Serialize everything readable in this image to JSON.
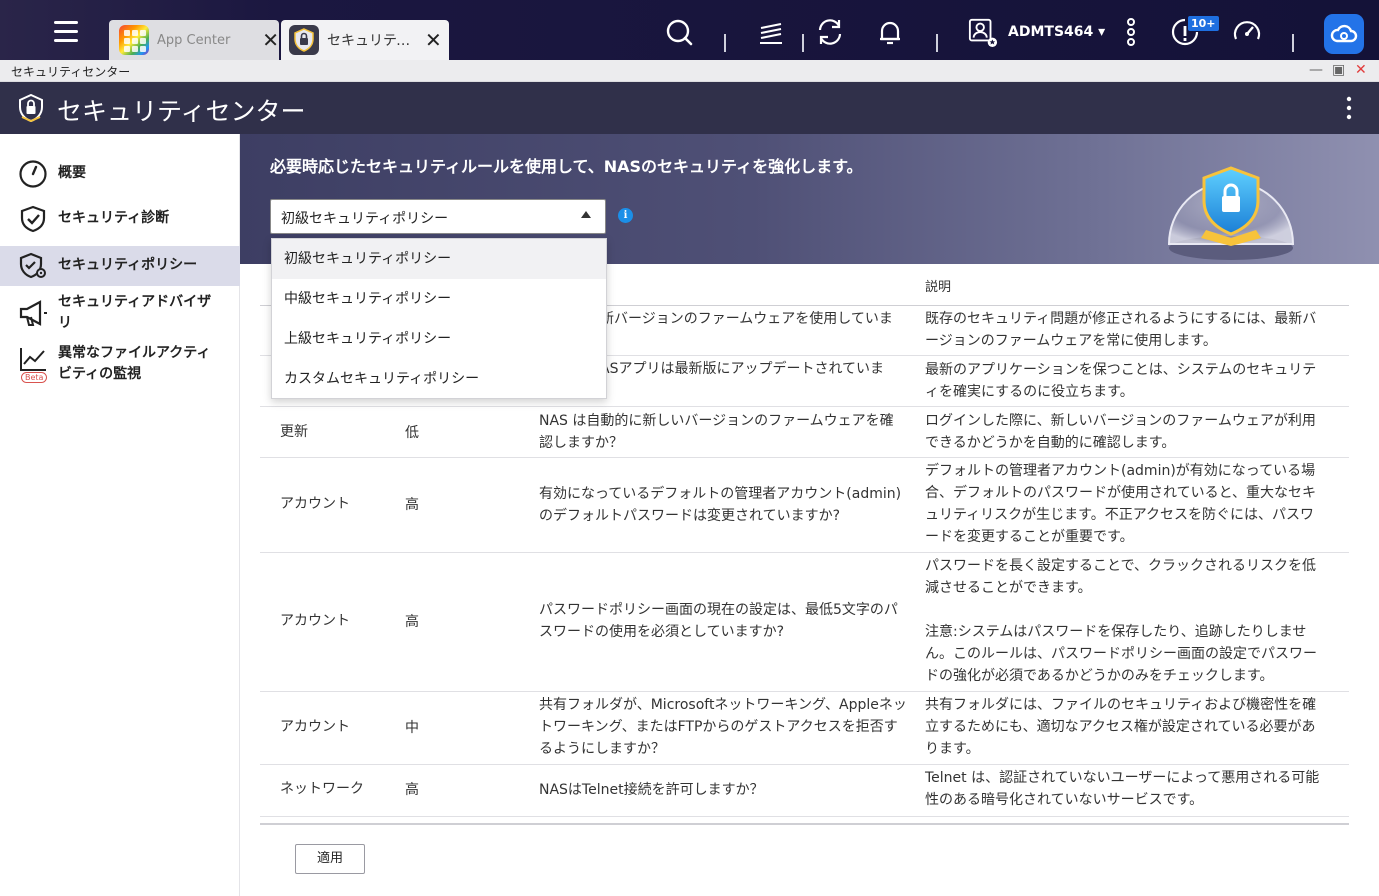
{
  "taskbar": {
    "tabs": [
      {
        "label": "App Center",
        "close": "✕"
      },
      {
        "label": "セキュリティセンター",
        "close": "✕"
      }
    ],
    "user": "ADMTS464 ▾",
    "notification_badge": "10+"
  },
  "window": {
    "title": "セキュリティセンター",
    "controls": {
      "minimize": "—",
      "maximize": "▣",
      "close": "✕"
    }
  },
  "app": {
    "title": "セキュリティセンター"
  },
  "sidebar": {
    "items": [
      {
        "label": "概要",
        "icon": "gauge-icon"
      },
      {
        "label": "セキュリティ診断",
        "icon": "shield-check-icon"
      },
      {
        "label": "セキュリティポリシー",
        "icon": "shield-gear-icon",
        "active": true
      },
      {
        "label_line1": "セキュリティアドバイザ",
        "label_line2": "リ",
        "icon": "megaphone-icon"
      },
      {
        "label_line1": "異常なファイルアクティ",
        "label_line2": "ビティの監視",
        "icon": "chart-line-icon",
        "badge": "Beta"
      }
    ]
  },
  "banner": {
    "text": "必要時応じたセキュリティルールを使用して、NASのセキュリティを強化します。",
    "select_value": "初級セキュリティポリシー",
    "info": "i"
  },
  "dropdown": {
    "options": [
      "初級セキュリティポリシー",
      "中級セキュリティポリシー",
      "上級セキュリティポリシー",
      "カスタムセキュリティポリシー"
    ],
    "selected_index": 0
  },
  "table": {
    "header_description": "説明",
    "rows": [
      {
        "question": "新バージョンのファームウェアを使用していま",
        "description": "既存のセキュリティ問題が修正されるようにするには、最新バージョンのファームウェアを常に使用します。"
      },
      {
        "question": "ASアプリは最新版にアップデートされていま",
        "description": "最新のアプリケーションを保つことは、システムのセキュリティを確実にするのに役立ちます。"
      },
      {
        "category": "更新",
        "severity": "低",
        "question": "NAS は自動的に新しいバージョンのファームウェアを確認しますか？",
        "description": "ログインした際に、新しいバージョンのファームウェアが利用できるかどうかを自動的に確認します。"
      },
      {
        "category": "アカウント",
        "severity": "高",
        "question": "有効になっているデフォルトの管理者アカウント(admin)のデフォルトパスワードは変更されていますか?",
        "description": "デフォルトの管理者アカウント(admin)が有効になっている場合、デフォルトのパスワードが使用されていると、重大なセキュリティリスクが生じます。不正アクセスを防ぐには、パスワードを変更することが重要です。"
      },
      {
        "category": "アカウント",
        "severity": "高",
        "question": "パスワードポリシー画面の現在の設定は、最低5文字のパスワードの使用を必須としていますか?",
        "description": "パスワードを長く設定することで、クラックされるリスクを低減させることができます。",
        "note": "注意:システムはパスワードを保存したり、追跡したりしません。このルールは、パスワードポリシー画面の設定でパスワードの強化が必須であるかどうかのみをチェックします。"
      },
      {
        "category": "アカウント",
        "severity": "中",
        "question": "共有フォルダが、Microsoftネットワーキング、Appleネットワーキング、またはFTPからのゲストアクセスを拒否するようにしますか？",
        "description": "共有フォルダには、ファイルのセキュリティおよび機密性を確立するためにも、適切なアクセス権が設定されている必要があります。"
      },
      {
        "category": "ネットワーク",
        "severity": "高",
        "question": "NASはTelnet接続を許可しますか？",
        "description": "Telnet は、認証されていないユーザーによって悪用される可能性のある暗号化されていないサービスです。"
      }
    ]
  },
  "apply_label": "適用",
  "colors": {
    "taskbar": "#1b1740",
    "header": "#30304a",
    "active_nav": "#dadbe9",
    "accent_blue": "#2373e8"
  }
}
